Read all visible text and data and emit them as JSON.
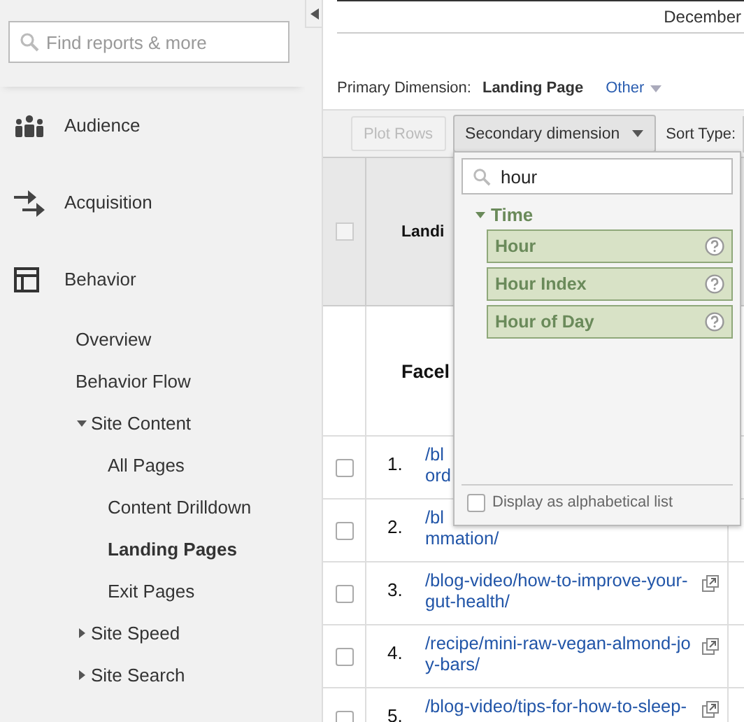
{
  "sidebar": {
    "search": {
      "placeholder": "Find reports & more"
    },
    "sections": [
      {
        "label": "Audience"
      },
      {
        "label": "Acquisition"
      },
      {
        "label": "Behavior",
        "children": [
          {
            "label": "Overview",
            "selected": false
          },
          {
            "label": "Behavior Flow",
            "selected": false
          },
          {
            "label": "Site Content",
            "selected": false,
            "expanded": true,
            "children": [
              {
                "label": "All Pages",
                "selected": false
              },
              {
                "label": "Content Drilldown",
                "selected": false
              },
              {
                "label": "Landing Pages",
                "selected": true
              },
              {
                "label": "Exit Pages",
                "selected": false
              }
            ]
          },
          {
            "label": "Site Speed",
            "selected": false,
            "expanded": false
          },
          {
            "label": "Site Search",
            "selected": false,
            "expanded": false
          }
        ]
      }
    ]
  },
  "date_range": "December",
  "primary_dimension": {
    "label": "Primary Dimension:",
    "value": "Landing Page",
    "other": "Other"
  },
  "toolbar": {
    "plot_rows": {
      "label": "Plot Rows",
      "disabled": true
    },
    "secondary_dimension": "Secondary dimension",
    "sort_type": "Sort Type:"
  },
  "table": {
    "header_checked": false,
    "columns": [
      {
        "label": "Landi"
      }
    ],
    "segment": "Facel",
    "rows": [
      {
        "checked": false,
        "index": "1.",
        "lines": [
          "/bl",
          "ord"
        ],
        "external": false
      },
      {
        "checked": false,
        "index": "2.",
        "lines": [
          "/bl",
          "mmation/"
        ],
        "external": false
      },
      {
        "checked": false,
        "index": "3.",
        "lines": [
          "/blog-video/how-to-improve-your-",
          "gut-health/"
        ],
        "external": true
      },
      {
        "checked": false,
        "index": "4.",
        "lines": [
          "/recipe/mini-raw-vegan-almond-jo",
          "y-bars/"
        ],
        "external": true
      },
      {
        "checked": false,
        "index": "5.",
        "lines": [
          "/blog-video/tips-for-how-to-sleep-"
        ],
        "external": true
      }
    ]
  },
  "dropdown": {
    "search": {
      "value": "hour"
    },
    "groups": [
      {
        "label": "Time",
        "expanded": true,
        "items": [
          {
            "label": "Hour"
          },
          {
            "label": "Hour Index"
          },
          {
            "label": "Hour of Day"
          }
        ]
      }
    ],
    "alphabetical": {
      "label": "Display as alphabetical list",
      "checked": false
    }
  }
}
